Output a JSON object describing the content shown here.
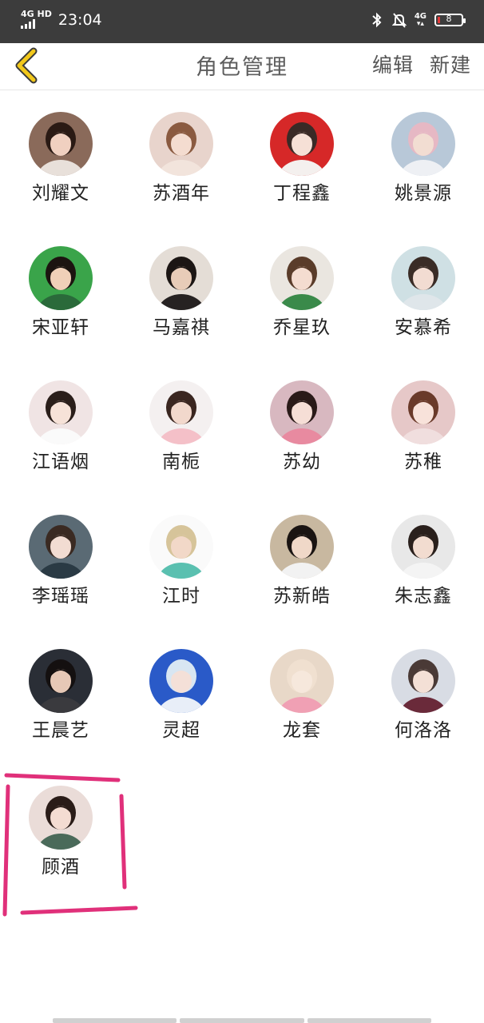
{
  "status_bar": {
    "network_left": "4G HD",
    "time": "23:04",
    "network_right": "4G",
    "battery": "8",
    "battery_level": 0.08
  },
  "header": {
    "title": "角色管理",
    "edit_label": "编辑",
    "new_label": "新建"
  },
  "roles": [
    {
      "name": "刘耀文",
      "bg": "#8a6a5a",
      "skin": "#f0d0c0",
      "hair": "#2a1a14",
      "top": "#e8e0da"
    },
    {
      "name": "苏酒年",
      "bg": "#e8d4cc",
      "skin": "#f4dcd0",
      "hair": "#8a5a40",
      "top": "#f2e4dc"
    },
    {
      "name": "丁程鑫",
      "bg": "#d62828",
      "skin": "#f6e0d6",
      "hair": "#3a2a26",
      "top": "#f4f0ee"
    },
    {
      "name": "姚景源",
      "bg": "#b8c8d8",
      "skin": "#f2ddd2",
      "hair": "#e6b8c4",
      "top": "#eef0f4"
    },
    {
      "name": "宋亚轩",
      "bg": "#3aa44a",
      "skin": "#f0d0b8",
      "hair": "#1c1410",
      "top": "#2a6a3a"
    },
    {
      "name": "马嘉祺",
      "bg": "#e4ddd6",
      "skin": "#e8ccb8",
      "hair": "#1c1614",
      "top": "#262222"
    },
    {
      "name": "乔星玖",
      "bg": "#eae6e0",
      "skin": "#f4dcd0",
      "hair": "#5a3c2a",
      "top": "#3a8a4a"
    },
    {
      "name": "安慕希",
      "bg": "#cfe0e4",
      "skin": "#f2dcd2",
      "hair": "#3a2c26",
      "top": "#dfe6ea"
    },
    {
      "name": "江语烟",
      "bg": "#f0e4e4",
      "skin": "#f6e2d8",
      "hair": "#2a1e1a",
      "top": "#fafafa"
    },
    {
      "name": "南栀",
      "bg": "#f4f0f0",
      "skin": "#f2d8cc",
      "hair": "#3a2620",
      "top": "#f4c0c8"
    },
    {
      "name": "苏幼",
      "bg": "#d8b8c0",
      "skin": "#f6ded6",
      "hair": "#2a1a18",
      "top": "#e88aa0"
    },
    {
      "name": "苏稚",
      "bg": "#e6c8c8",
      "skin": "#f8e2da",
      "hair": "#6a3a2a",
      "top": "#f0dede"
    },
    {
      "name": "李瑶瑶",
      "bg": "#5a6a74",
      "skin": "#f2dcd2",
      "hair": "#3a2a22",
      "top": "#2a3a44"
    },
    {
      "name": "江时",
      "bg": "#fafafa",
      "skin": "#f2d8c8",
      "hair": "#d6c49a",
      "top": "#5ac0b0"
    },
    {
      "name": "苏新皓",
      "bg": "#c8b8a0",
      "skin": "#f0d8c8",
      "hair": "#1a1412",
      "top": "#f2f2f2"
    },
    {
      "name": "朱志鑫",
      "bg": "#e8e8e8",
      "skin": "#f2dcd0",
      "hair": "#2a201c",
      "top": "#f4f4f4"
    },
    {
      "name": "王晨艺",
      "bg": "#2a2e36",
      "skin": "#e6c8b6",
      "hair": "#141010",
      "top": "#3a3a3e"
    },
    {
      "name": "灵超",
      "bg": "#2a5ac8",
      "skin": "#f4e0d8",
      "hair": "#d8e6f2",
      "top": "#e8eef8"
    },
    {
      "name": "龙套",
      "bg": "#e8d8c8",
      "skin": "#f6e8dc",
      "hair": "#f0e0d0",
      "top": "#f0a0b4"
    },
    {
      "name": "何洛洛",
      "bg": "#d8dce4",
      "skin": "#f4e0d6",
      "hair": "#4a3a36",
      "top": "#6a2a3a"
    },
    {
      "name": "顾酒",
      "bg": "#eadcd8",
      "skin": "#f4dcd2",
      "hair": "#2a1c18",
      "top": "#4a6a5a"
    }
  ]
}
